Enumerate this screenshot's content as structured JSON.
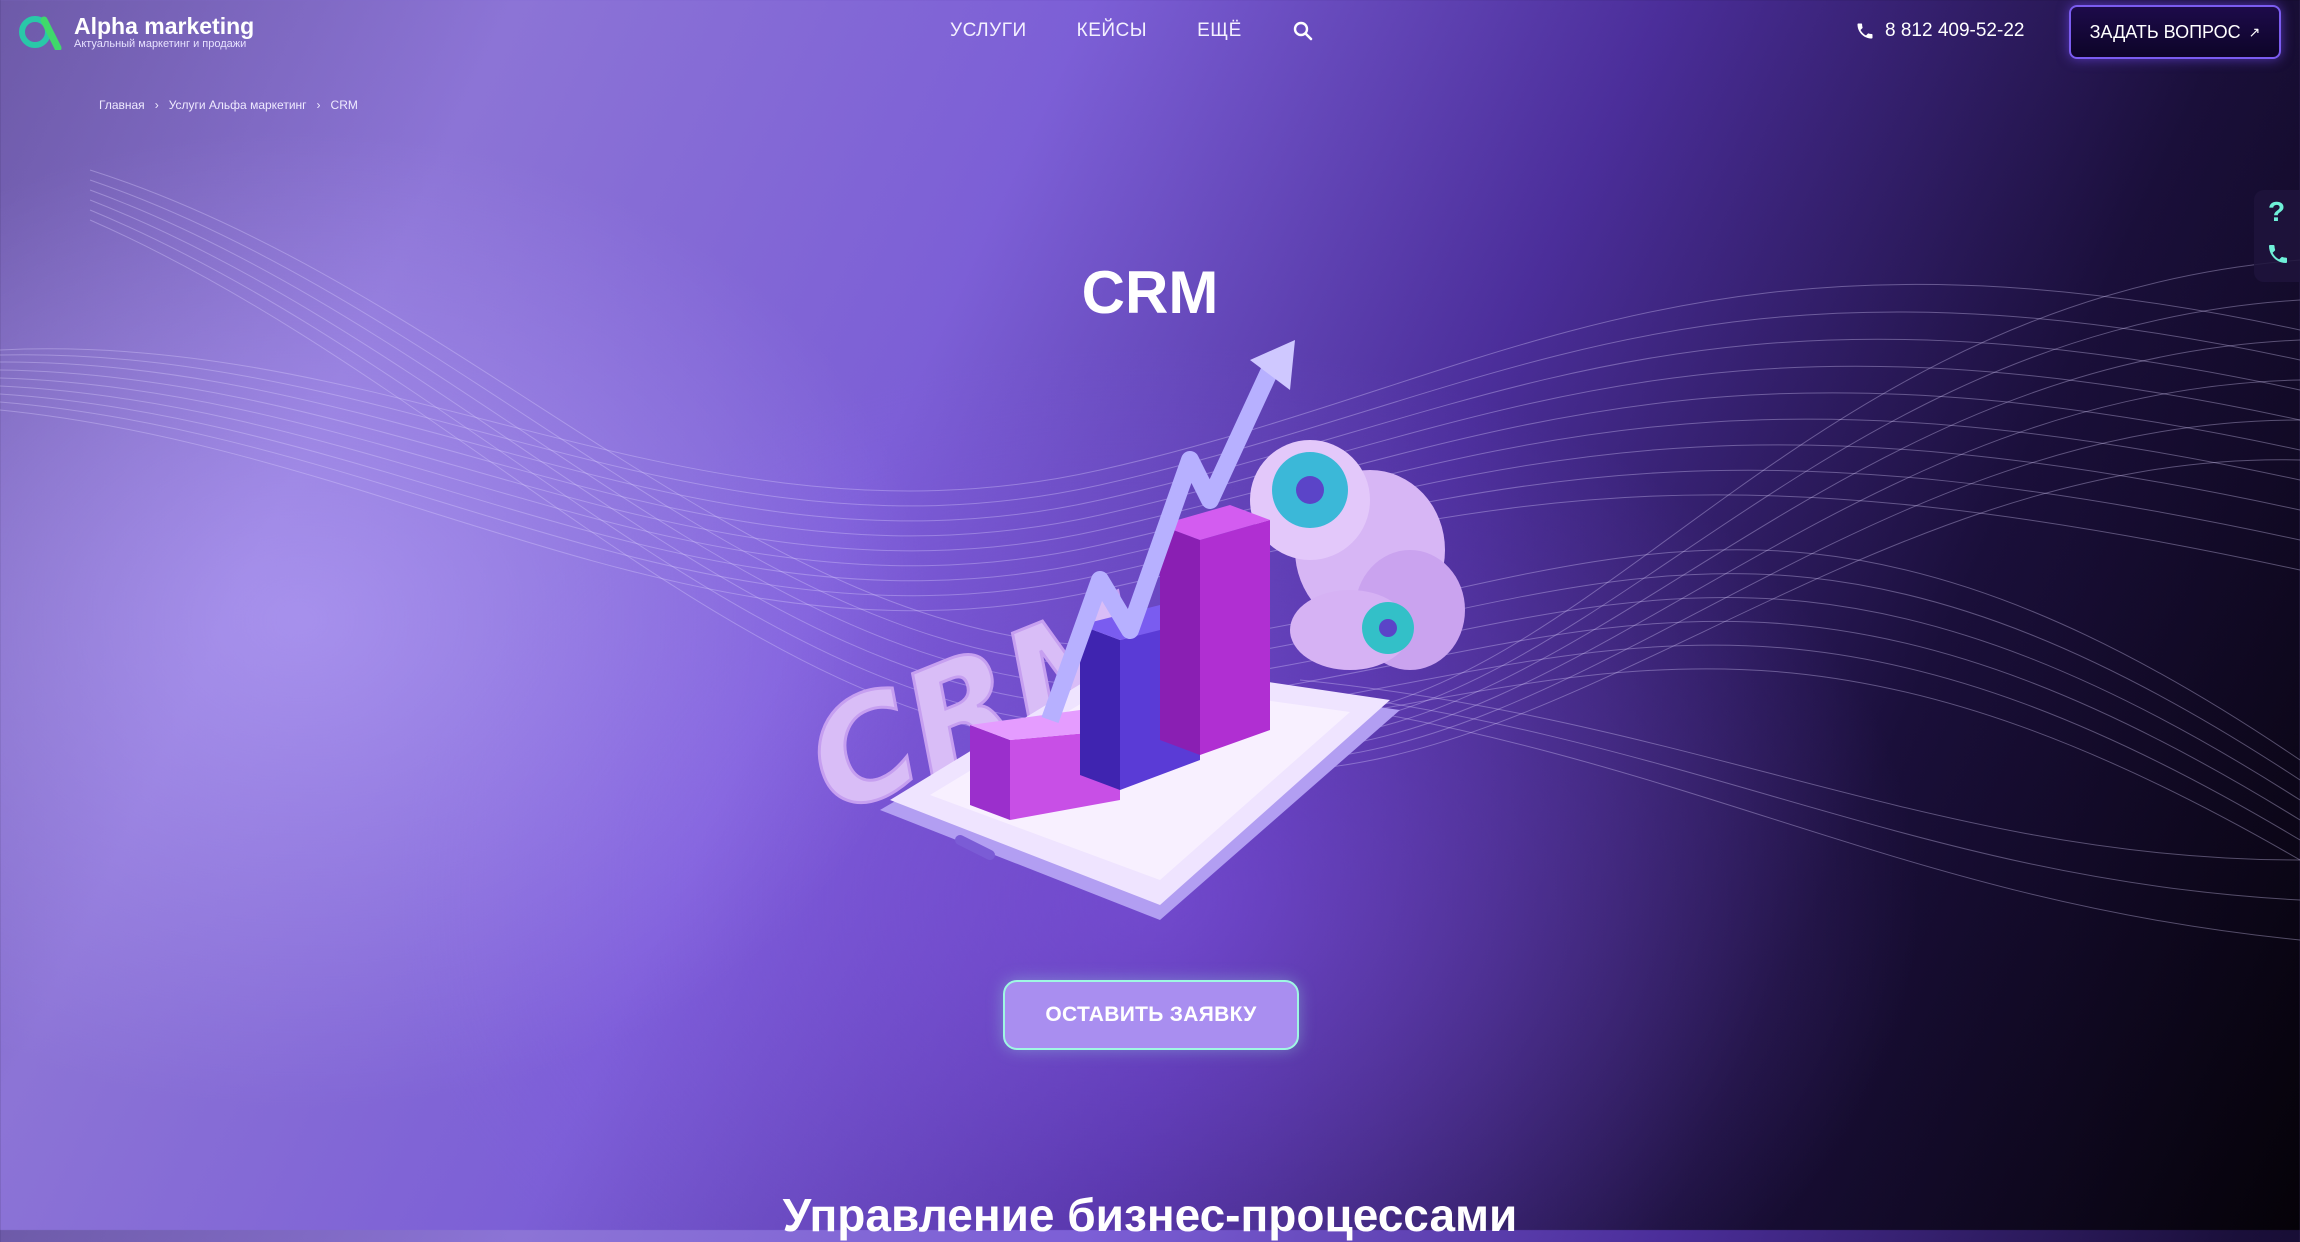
{
  "header": {
    "logo_title": "Alpha marketing",
    "logo_subtitle": "Актуальный маркетинг и продажи",
    "nav": [
      "УСЛУГИ",
      "КЕЙСЫ",
      "ЕЩЁ"
    ],
    "phone": "8 812 409-52-22",
    "ask_button": "ЗАДАТЬ ВОПРОС"
  },
  "breadcrumb": [
    "Главная",
    "Услуги Альфа маркетинг",
    "CRM"
  ],
  "hero": {
    "title": "CRM",
    "cta": "ОСТАВИТЬ ЗАЯВКУ",
    "illustration_text": "CRM"
  },
  "section": {
    "title": "Управление бизнес-процессами"
  },
  "colors": {
    "accent_mint": "#6ff0d8",
    "button_purple": "#a98ef0",
    "dark_button": "#1d0b4a"
  }
}
